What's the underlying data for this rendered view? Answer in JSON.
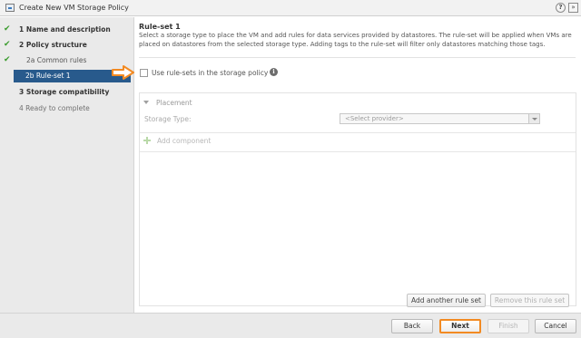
{
  "window": {
    "title": "Create New VM Storage Policy",
    "help_label": "?",
    "expand_label": "»"
  },
  "steps": [
    {
      "label": "1  Name and description",
      "completed": true
    },
    {
      "label": "2  Policy structure",
      "completed": true
    },
    {
      "label": "2a  Common rules",
      "completed": true
    },
    {
      "label": "2b  Rule-set 1",
      "active": true
    },
    {
      "label": "3  Storage compatibility"
    },
    {
      "label": "4  Ready to complete"
    }
  ],
  "main": {
    "heading": "Rule-set 1",
    "description": "Select a storage type to place the VM and add rules for data services provided by datastores. The rule-set will be applied when VMs are placed on datastores from the selected storage type. Adding tags to the rule-set will filter only datastores matching those tags.",
    "use_rulesets_label": "Use rule-sets in the storage policy",
    "use_rulesets_checked": false,
    "info_icon": "i",
    "placement_label": "Placement",
    "storage_type_label": "Storage Type:",
    "storage_type_value": "<Select provider>",
    "add_component_label": "Add component",
    "add_ruleset_label": "Add another rule set",
    "remove_ruleset_label": "Remove this rule set"
  },
  "footer": {
    "back_label": "Back",
    "next_label": "Next",
    "finish_label": "Finish",
    "cancel_label": "Cancel"
  },
  "colors": {
    "active_step": "#285a8c",
    "check": "#3b9c2e",
    "highlight": "#f28a22"
  }
}
